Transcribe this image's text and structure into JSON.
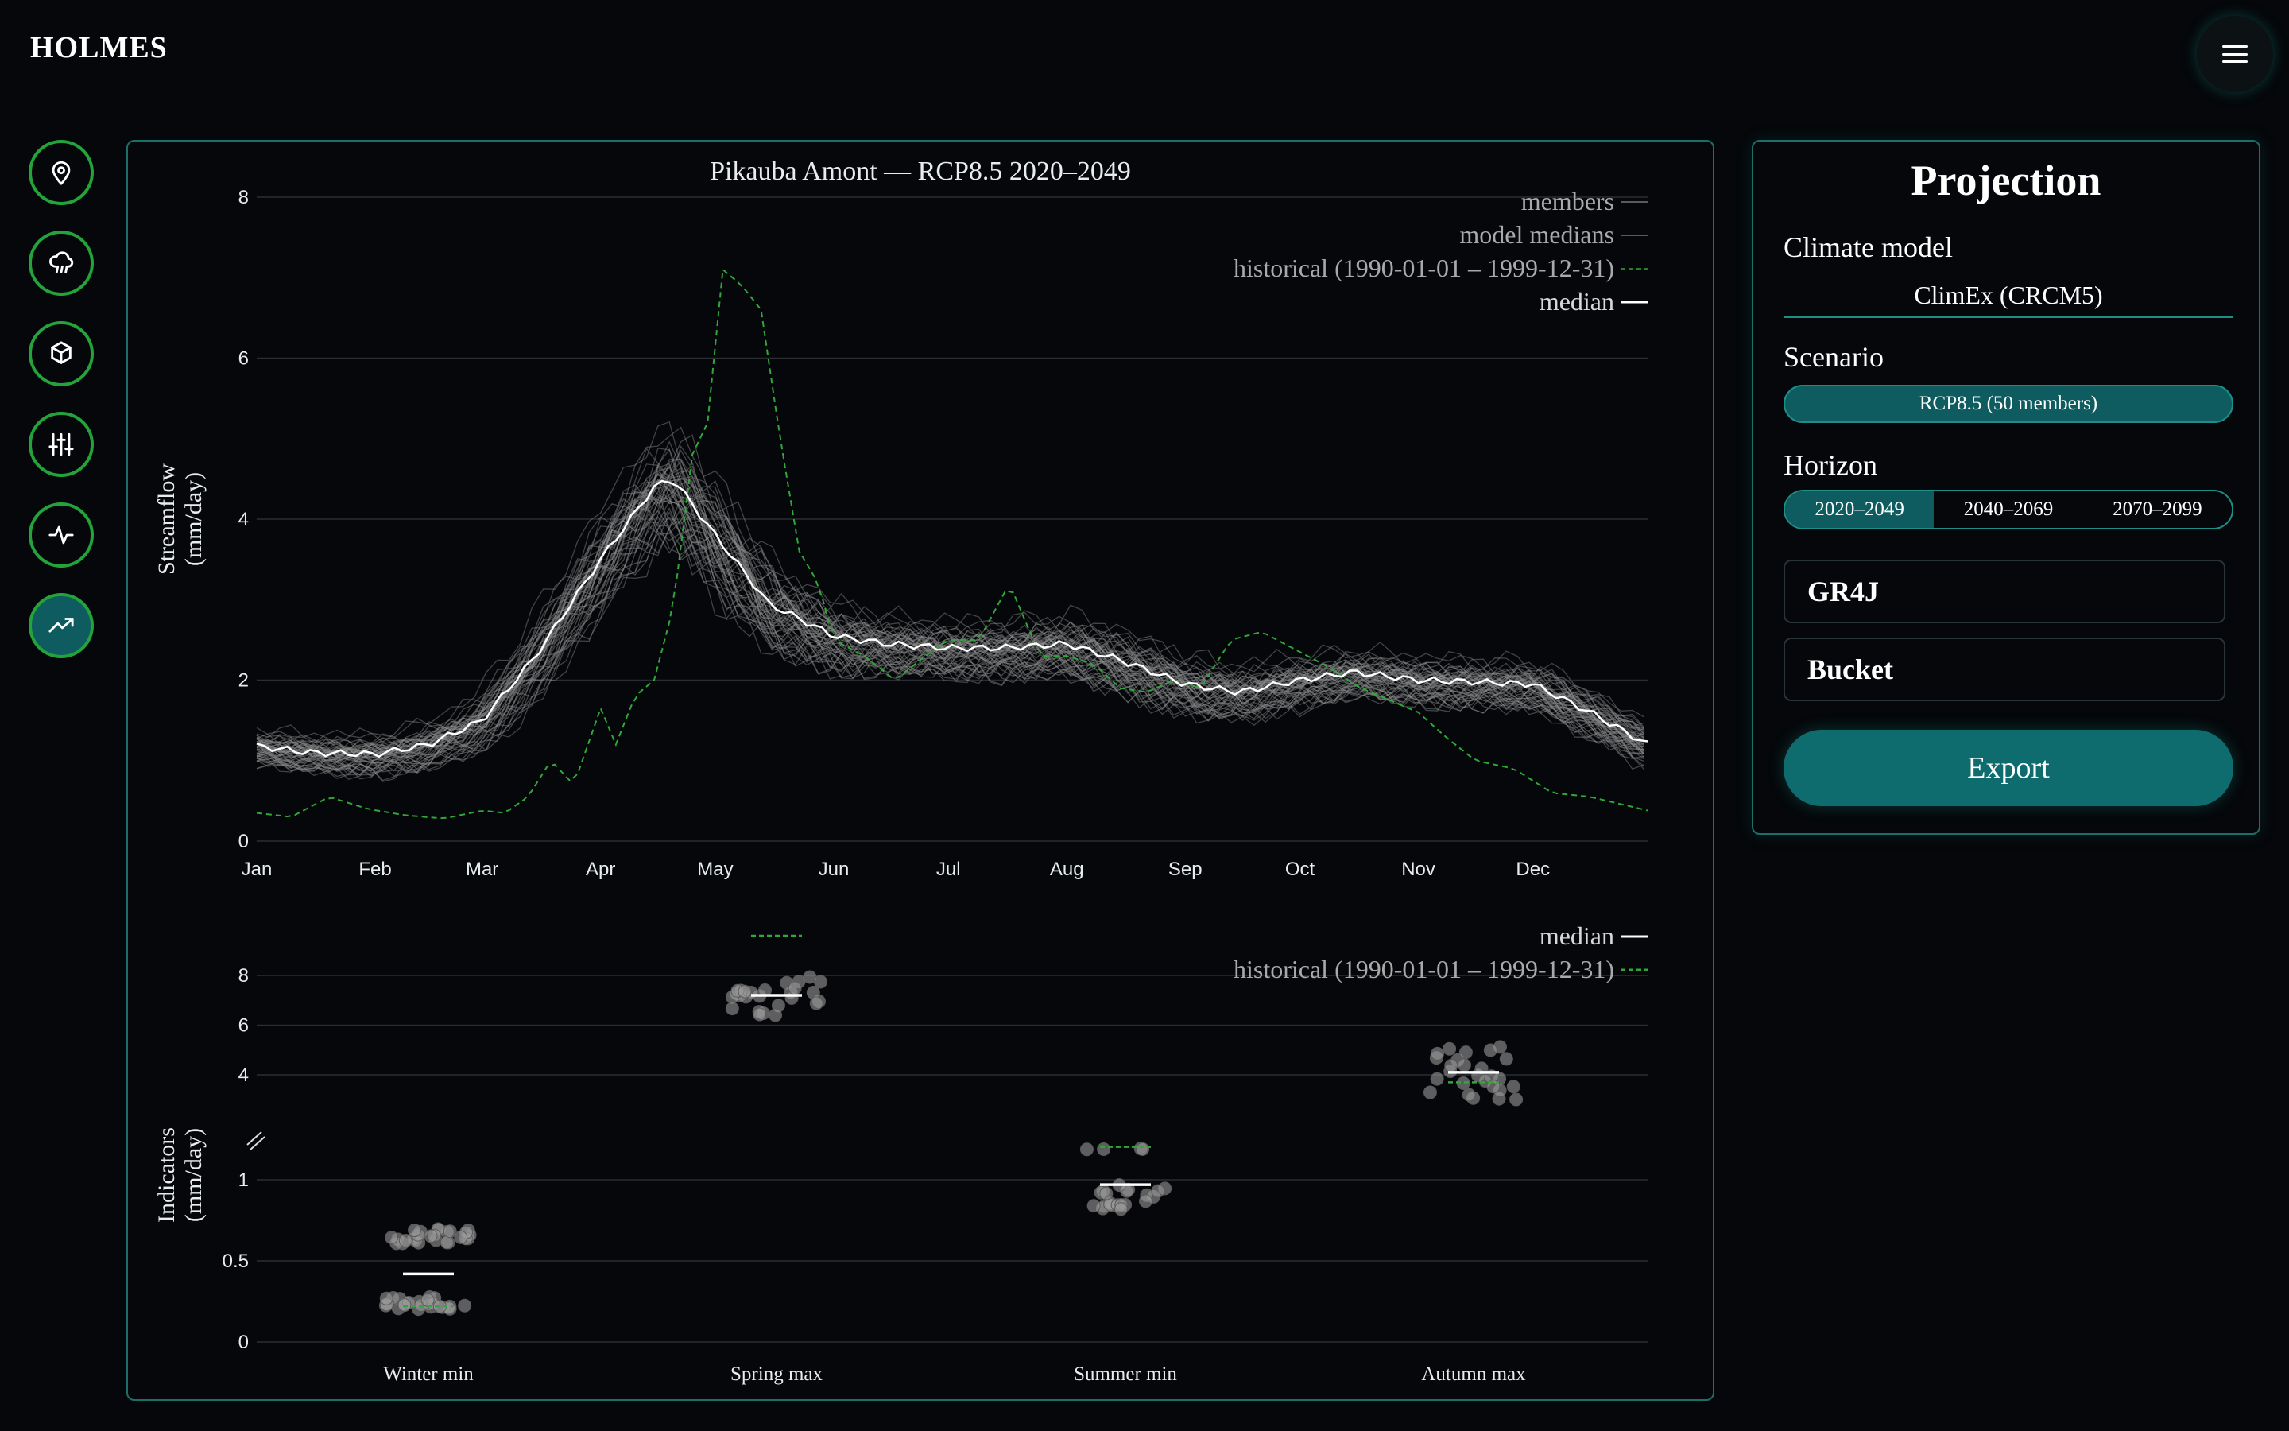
{
  "app": {
    "brand": "HOLMES"
  },
  "rail": [
    {
      "icon": "map-pin-icon"
    },
    {
      "icon": "cloud-rain-icon"
    },
    {
      "icon": "cube-icon"
    },
    {
      "icon": "sliders-icon"
    },
    {
      "icon": "activity-icon"
    },
    {
      "icon": "trending-up-icon",
      "active": true
    }
  ],
  "projection": {
    "title": "Projection",
    "climate_model_label": "Climate model",
    "climate_model_value": "ClimEx (CRCM5)",
    "scenario_label": "Scenario",
    "scenario_value": "RCP8.5 (50 members)",
    "horizon_label": "Horizon",
    "horizons": [
      "2020–2049",
      "2040–2069",
      "2070–2099"
    ],
    "horizon_selected": "2020–2049",
    "hydro_model": "GR4J",
    "snow_model": "Bucket",
    "export_label": "Export"
  },
  "chart_data": [
    {
      "type": "line",
      "title": "Pikauba Amont — RCP8.5 2020–2049",
      "xlabel": "",
      "ylabel": "Streamflow\n(mm/day)",
      "ylim": [
        0,
        8
      ],
      "yticks": [
        "0",
        "2",
        "4",
        "6",
        "8"
      ],
      "xticks": [
        "Jan",
        "Feb",
        "Mar",
        "Apr",
        "May",
        "Jun",
        "Jul",
        "Aug",
        "Sep",
        "Oct",
        "Nov",
        "Dec"
      ],
      "grid": true,
      "legend_position": "top-right",
      "legend": [
        "members",
        "model medians",
        "historical (1990-01-01 – 1999-12-31)",
        "median"
      ],
      "members_count": 50,
      "members_spread": [
        0.22,
        0.25,
        0.3,
        0.45,
        0.7,
        0.5,
        0.35,
        0.35,
        0.4,
        0.35,
        0.3,
        0.3,
        0.3,
        0.25
      ],
      "colors": {
        "members": "#8d8d8d",
        "median": "#ffffff",
        "historical": "#2fa838"
      },
      "series": [
        {
          "name": "median",
          "x": [
            1,
            15,
            32,
            46,
            60,
            74,
            91,
            105,
            110,
            121,
            135,
            152,
            166,
            182,
            196,
            213,
            227,
            244,
            258,
            274,
            288,
            305,
            319,
            335,
            350,
            365
          ],
          "y": [
            1.18,
            1.1,
            1.08,
            1.2,
            1.5,
            2.3,
            3.5,
            4.4,
            4.5,
            3.8,
            2.95,
            2.55,
            2.45,
            2.4,
            2.4,
            2.45,
            2.25,
            1.95,
            1.85,
            2.0,
            2.1,
            2.0,
            1.98,
            1.95,
            1.6,
            1.2
          ]
        },
        {
          "name": "historical (1990-01-01 – 1999-12-31)",
          "x": [
            1,
            10,
            20,
            30,
            40,
            50,
            60,
            66,
            72,
            78,
            84,
            91,
            95,
            100,
            105,
            110,
            115,
            119,
            123,
            128,
            133,
            138,
            143,
            148,
            152,
            160,
            168,
            176,
            182,
            190,
            198,
            206,
            213,
            220,
            227,
            234,
            241,
            248,
            256,
            264,
            272,
            280,
            290,
            300,
            305,
            312,
            320,
            330,
            340,
            350,
            365
          ],
          "y": [
            0.35,
            0.3,
            0.55,
            0.4,
            0.32,
            0.28,
            0.38,
            0.35,
            0.55,
            1.0,
            0.7,
            1.65,
            1.2,
            1.8,
            2.0,
            2.9,
            4.8,
            5.2,
            7.1,
            6.9,
            6.6,
            5.0,
            3.6,
            3.2,
            2.5,
            2.3,
            2.0,
            2.3,
            2.5,
            2.5,
            3.2,
            2.3,
            2.3,
            2.2,
            1.9,
            1.85,
            2.0,
            1.9,
            2.5,
            2.6,
            2.4,
            2.2,
            1.9,
            1.7,
            1.6,
            1.3,
            1.0,
            0.9,
            0.6,
            0.55,
            0.38
          ]
        }
      ]
    },
    {
      "type": "scatter",
      "title": "",
      "xlabel": "",
      "ylabel": "Indicators\n(mm/day)",
      "yticks": [
        "0",
        "0.5",
        "1",
        "4",
        "6",
        "8"
      ],
      "axis_break": true,
      "grid": true,
      "legend_position": "top-right",
      "legend": [
        "median",
        "historical (1990-01-01 – 1999-12-31)"
      ],
      "categories": [
        "Winter min",
        "Spring max",
        "Summer min",
        "Autumn max"
      ],
      "median": [
        0.42,
        7.2,
        0.97,
        4.1
      ],
      "historical": [
        0.22,
        9.6,
        1.1,
        3.7
      ],
      "member_ranges": [
        [
          0.2,
          0.28,
          0.6,
          0.7
        ],
        [
          6.4,
          8.0
        ],
        [
          0.82,
          1.06
        ],
        [
          3.0,
          5.2
        ]
      ]
    }
  ]
}
